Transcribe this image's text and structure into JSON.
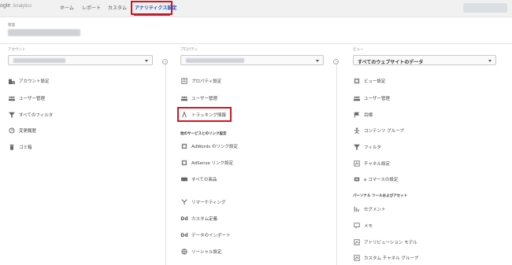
{
  "header": {
    "logo_partial": "ogle",
    "logo_product": "Analytics",
    "nav": [
      "ホーム",
      "レポート",
      "カスタム",
      "アナリティクス設定"
    ]
  },
  "admin": {
    "label": "管理"
  },
  "account": {
    "label": "アカウント",
    "items": [
      "アカウント設定",
      "ユーザー管理",
      "すべてのフィルタ",
      "変更履歴",
      "ゴミ箱"
    ]
  },
  "property": {
    "label": "プロパティ",
    "items": [
      "プロパティ設定",
      "ユーザー管理",
      "トラッキング情報"
    ],
    "section_title": "他のサービスとのリンク設定",
    "link_items": [
      "AdWords のリンク設定",
      "AdSense リンク設定",
      "すべての商品"
    ],
    "more_items": [
      "リマーケティング",
      "カスタム定義",
      "データのインポート",
      "ソーシャル設定"
    ]
  },
  "view": {
    "label": "ビュー",
    "selected": "すべてのウェブサイトのデータ",
    "items": [
      "ビュー設定",
      "ユーザー管理",
      "目標",
      "コンテンツ グループ",
      "フィルタ",
      "チャネル設定",
      "e コマースの設定"
    ],
    "section_title": "パーソナル ツールおよびアセット",
    "tool_items": [
      "セグメント",
      "メモ",
      "アトリビューション モデル",
      "カスタム チャネル グループ"
    ]
  },
  "colors": {
    "accent": "#1a57c9",
    "highlight": "#d6131b"
  }
}
